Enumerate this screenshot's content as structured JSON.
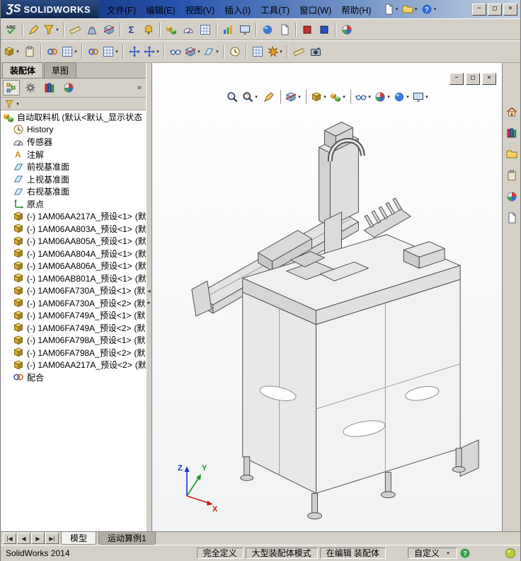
{
  "ui": {
    "caret": "▾"
  },
  "titlebar": {
    "logo_mark": "ƷS",
    "logo_text": "SOLIDWORKS",
    "menus": [
      {
        "name": "file",
        "label": "文件(F)"
      },
      {
        "name": "edit",
        "label": "编辑(E)"
      },
      {
        "name": "view",
        "label": "视图(V)"
      },
      {
        "name": "insert",
        "label": "插入(I)"
      },
      {
        "name": "tools",
        "label": "工具(T)"
      },
      {
        "name": "window",
        "label": "窗口(W)"
      },
      {
        "name": "help",
        "label": "帮助(H)"
      }
    ],
    "quick_tools": [
      {
        "name": "new-document",
        "kind": "doc",
        "caret": true
      },
      {
        "name": "open-document",
        "kind": "folder",
        "caret": true
      },
      {
        "name": "help",
        "kind": "help",
        "caret": true
      }
    ],
    "window_buttons": [
      {
        "name": "minimize",
        "glyph": "−"
      },
      {
        "name": "maximize",
        "glyph": "□"
      },
      {
        "name": "close",
        "glyph": "×"
      }
    ]
  },
  "toolbars": {
    "row1": [
      {
        "name": "spellcheck",
        "kind": "abc"
      },
      {
        "sep": true
      },
      {
        "name": "format-painter",
        "kind": "wand"
      },
      {
        "name": "selection-filter",
        "kind": "funnel",
        "caret": true
      },
      {
        "sep": true
      },
      {
        "name": "measure",
        "kind": "ruler"
      },
      {
        "name": "mass-properties",
        "kind": "mass"
      },
      {
        "name": "section-properties",
        "kind": "section"
      },
      {
        "sep": true
      },
      {
        "name": "equations",
        "kind": "sigma"
      },
      {
        "name": "sensor",
        "kind": "bell"
      },
      {
        "sep": true
      },
      {
        "name": "interference-detection",
        "kind": "cubes"
      },
      {
        "name": "clearance-verification",
        "kind": "gauge"
      },
      {
        "name": "hole-alignment",
        "kind": "grid"
      },
      {
        "sep": true
      },
      {
        "name": "assembly-visualization",
        "kind": "chart"
      },
      {
        "name": "performance-evaluation",
        "kind": "monitor"
      },
      {
        "sep": true
      },
      {
        "name": "curvature",
        "kind": "sphere"
      },
      {
        "name": "compare-documents",
        "kind": "doc"
      },
      {
        "sep": true
      },
      {
        "name": "markup-red",
        "kind": "red"
      },
      {
        "name": "markup-blue",
        "kind": "blue"
      },
      {
        "sep": true
      },
      {
        "name": "render-preview",
        "kind": "pie"
      }
    ],
    "row2": [
      {
        "name": "insert-component",
        "kind": "cube",
        "caret": true
      },
      {
        "name": "view-palette-paste",
        "kind": "clipboard"
      },
      {
        "sep": true
      },
      {
        "name": "hyperlink",
        "kind": "rings"
      },
      {
        "name": "design-table",
        "kind": "grid",
        "caret": true
      },
      {
        "sep": true
      },
      {
        "name": "mate",
        "kind": "rings"
      },
      {
        "name": "linear-component-pattern",
        "kind": "grid",
        "caret": true
      },
      {
        "sep": true
      },
      {
        "name": "move-component",
        "kind": "arrows"
      },
      {
        "name": "rotate-component",
        "kind": "arrows",
        "caret": true
      },
      {
        "sep": true
      },
      {
        "name": "show-hidden-components",
        "kind": "glasses"
      },
      {
        "name": "assembly-features",
        "kind": "section",
        "caret": true
      },
      {
        "name": "reference-geometry",
        "kind": "plane",
        "caret": true
      },
      {
        "sep": true
      },
      {
        "name": "new-motion-study",
        "kind": "clock"
      },
      {
        "sep": true
      },
      {
        "name": "bill-of-materials",
        "kind": "grid"
      },
      {
        "name": "exploded-view",
        "kind": "burst",
        "caret": true
      },
      {
        "sep": true
      },
      {
        "name": "instant3d",
        "kind": "ruler"
      },
      {
        "name": "snapshot",
        "kind": "camera"
      }
    ]
  },
  "left_panel": {
    "command_tabs": [
      {
        "name": "assembly",
        "label": "装配体",
        "active": true
      },
      {
        "name": "sketch",
        "label": "草图",
        "active": false
      }
    ],
    "fm_tabs": [
      {
        "name": "featuremanager-design-tree",
        "kind": "tree",
        "active": true
      },
      {
        "name": "propertymanager",
        "kind": "gear",
        "active": false
      },
      {
        "name": "configurationmanager",
        "kind": "books",
        "active": false
      },
      {
        "name": "displaymanager",
        "kind": "pie",
        "active": false
      }
    ],
    "fm_overflow": "»",
    "splitter_glyphs": [
      "◂",
      "▸"
    ],
    "tree": {
      "root": {
        "icon": "cubes",
        "label": "自动取料机 (默认<默认_显示状态"
      },
      "items": [
        {
          "icon": "clock",
          "label": "History"
        },
        {
          "icon": "gauge",
          "label": "传感器"
        },
        {
          "icon": "annotation",
          "label": "注解"
        },
        {
          "icon": "plane",
          "label": "前视基准面"
        },
        {
          "icon": "plane",
          "label": "上视基准面"
        },
        {
          "icon": "plane",
          "label": "右视基准面"
        },
        {
          "icon": "origin",
          "label": "原点"
        },
        {
          "icon": "cube",
          "prefix": "(-)",
          "label": "1AM06AA217A_预设<1>",
          "suffix": "(默"
        },
        {
          "icon": "cube",
          "prefix": "(-)",
          "label": "1AM06AA803A_预设<1>",
          "suffix": "(默"
        },
        {
          "icon": "cube",
          "prefix": "(-)",
          "label": "1AM06AA805A_预设<1>",
          "suffix": "(默"
        },
        {
          "icon": "cube",
          "prefix": "(-)",
          "label": "1AM06AA804A_预设<1>",
          "suffix": "(默"
        },
        {
          "icon": "cube",
          "prefix": "(-)",
          "label": "1AM06AA806A_预设<1>",
          "suffix": "(默"
        },
        {
          "icon": "cube",
          "prefix": "(-)",
          "label": "1AM06AB801A_预设<1>",
          "suffix": "(默"
        },
        {
          "icon": "cube",
          "prefix": "(-)",
          "label": "1AM06FA730A_预设<1>",
          "suffix": "(默"
        },
        {
          "icon": "cube",
          "prefix": "(-)",
          "label": "1AM06FA730A_预设<2>",
          "suffix": "(默"
        },
        {
          "icon": "cube",
          "prefix": "(-)",
          "label": "1AM06FA749A_预设<1>",
          "suffix": "(默"
        },
        {
          "icon": "cube",
          "prefix": "(-)",
          "label": "1AM06FA749A_预设<2>",
          "suffix": "(默"
        },
        {
          "icon": "cube",
          "prefix": "(-)",
          "label": "1AM06FA798A_预设<1>",
          "suffix": "(默"
        },
        {
          "icon": "cube",
          "prefix": "(-)",
          "label": "1AM06FA798A_预设<2>",
          "suffix": "(默"
        },
        {
          "icon": "cube",
          "prefix": "(-)",
          "label": "1AM06AA217A_预设<2>",
          "suffix": "(默"
        },
        {
          "icon": "rings",
          "label": "配合"
        }
      ]
    }
  },
  "viewport": {
    "doc_buttons": [
      {
        "name": "doc-minimize",
        "glyph": "−"
      },
      {
        "name": "doc-restore",
        "glyph": "□"
      },
      {
        "name": "doc-close",
        "glyph": "×"
      }
    ],
    "headsup": [
      {
        "name": "zoom-to-fit",
        "kind": "mag"
      },
      {
        "name": "zoom-to-area",
        "kind": "magzone",
        "caret": true
      },
      {
        "name": "previous-view",
        "kind": "wand"
      },
      {
        "sep": true
      },
      {
        "name": "section-view",
        "kind": "section",
        "caret": true
      },
      {
        "sep": true
      },
      {
        "name": "view-orientation",
        "kind": "cube",
        "caret": true
      },
      {
        "name": "display-style",
        "kind": "cubes",
        "caret": true
      },
      {
        "sep": true
      },
      {
        "name": "hide-show-items",
        "kind": "glasses",
        "caret": true
      },
      {
        "name": "edit-appearance",
        "kind": "pie",
        "caret": true
      },
      {
        "name": "apply-scene",
        "kind": "sphere",
        "caret": true
      },
      {
        "name": "view-settings",
        "kind": "monitor",
        "caret": true
      }
    ],
    "triad": {
      "x": "X",
      "y": "Y",
      "z": "Z"
    }
  },
  "taskpane": [
    {
      "name": "solidworks-resources",
      "kind": "home"
    },
    {
      "name": "design-library",
      "kind": "books"
    },
    {
      "name": "file-explorer",
      "kind": "folder"
    },
    {
      "name": "view-palette",
      "kind": "clipboard"
    },
    {
      "name": "appearances-scenes",
      "kind": "pie"
    },
    {
      "name": "custom-properties",
      "kind": "doc"
    }
  ],
  "bottom": {
    "nav": [
      "|◀",
      "◀",
      "▶",
      "▶|"
    ],
    "tabs": [
      {
        "name": "model",
        "label": "模型",
        "active": true
      },
      {
        "name": "motion-study-1",
        "label": "运动算例1",
        "active": false
      }
    ]
  },
  "statusbar": {
    "app": "SolidWorks 2014",
    "segments": [
      "完全定义",
      "大型装配体模式",
      "在编辑 装配体"
    ],
    "custom_label": "自定义",
    "icons": [
      {
        "name": "quick-tips",
        "kind": "helpg"
      },
      {
        "name": "performance-orb",
        "kind": "orb"
      }
    ]
  }
}
